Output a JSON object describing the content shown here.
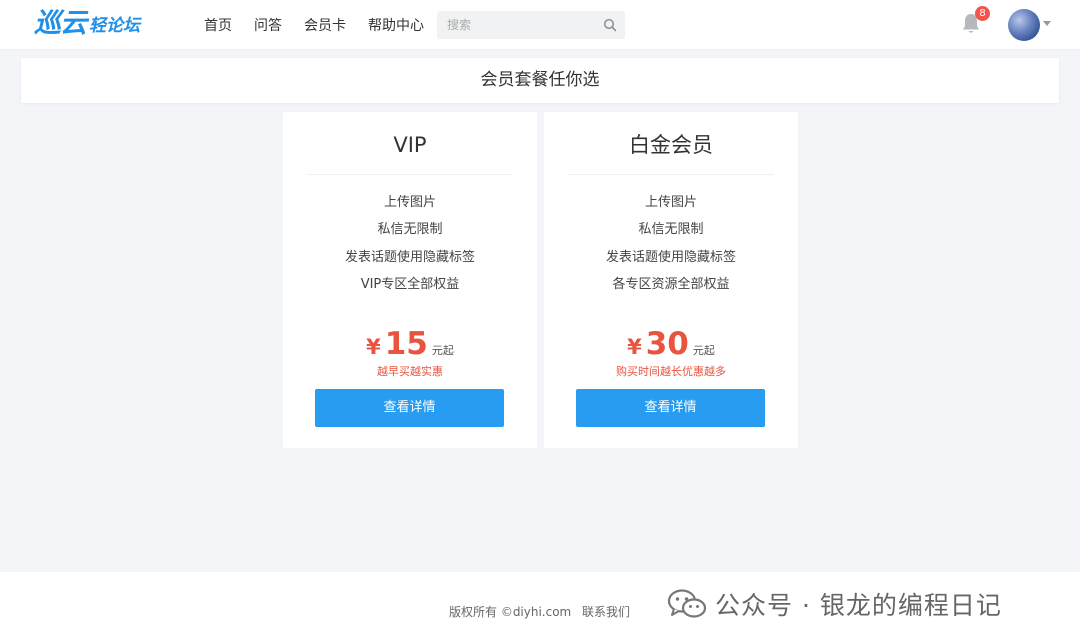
{
  "header": {
    "logo_main": "巡云",
    "logo_sub": "轻论坛",
    "nav": [
      "首页",
      "问答",
      "会员卡",
      "帮助中心"
    ],
    "search_placeholder": "搜索",
    "notification_count": "8"
  },
  "page_title": "会员套餐任你选",
  "plans": [
    {
      "name": "VIP",
      "features": [
        "上传图片",
        "私信无限制",
        "发表话题使用隐藏标签",
        "VIP专区全部权益"
      ],
      "currency": "¥",
      "price": "15",
      "unit": "元起",
      "promo": "越早买越实惠",
      "button": "查看详情"
    },
    {
      "name": "白金会员",
      "features": [
        "上传图片",
        "私信无限制",
        "发表话题使用隐藏标签",
        "各专区资源全部权益"
      ],
      "currency": "¥",
      "price": "30",
      "unit": "元起",
      "promo": "购买时间越长优惠越多",
      "button": "查看详情"
    }
  ],
  "footer": {
    "copyright": "版权所有 ©diyhi.com",
    "contact": "联系我们",
    "watermark": "公众号 · 银龙的编程日记"
  },
  "colors": {
    "brand": "#1f8fe8",
    "button": "#289cf0",
    "price": "#e8543f",
    "badge": "#f2554e"
  }
}
